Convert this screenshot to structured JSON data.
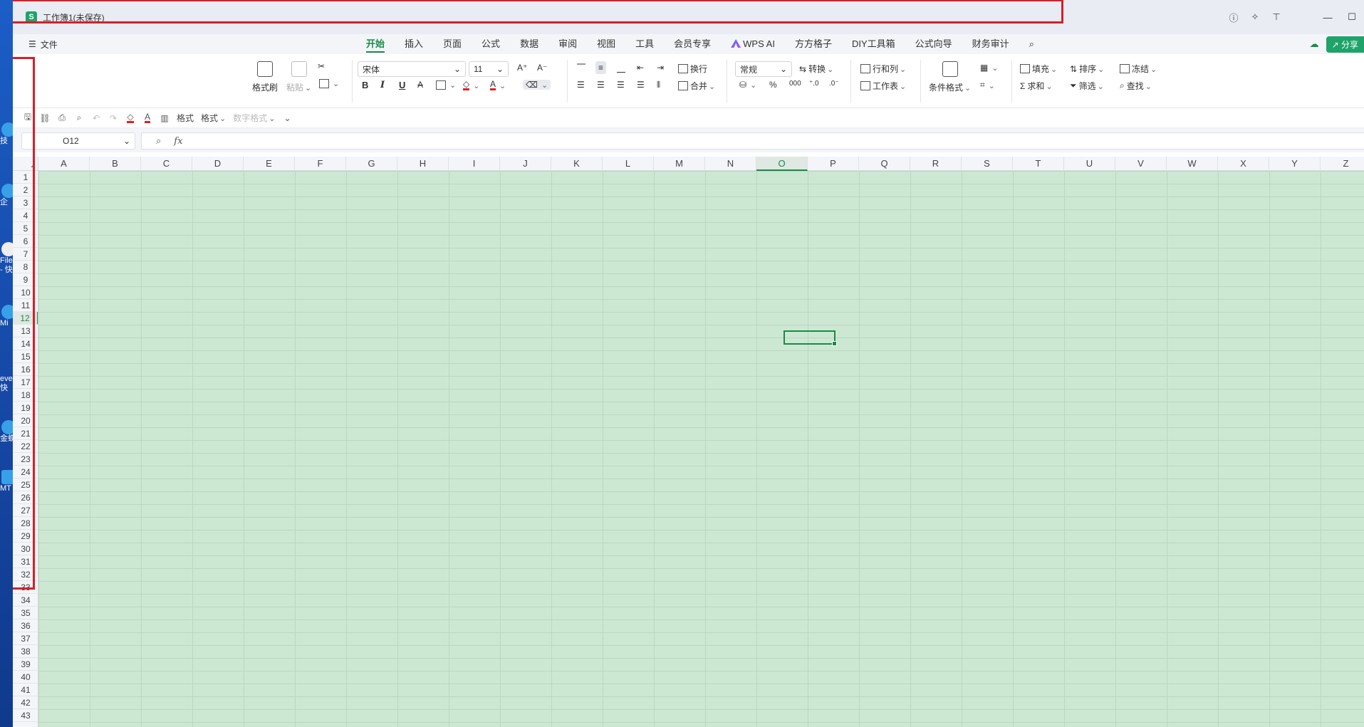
{
  "desktop": {
    "icons": [
      "技",
      "企",
      "File",
      "- 快",
      "Mi",
      "eve",
      "快",
      "金蝶",
      "MT"
    ]
  },
  "window": {
    "title": "工作簿1(未保存)",
    "app_letter": "S"
  },
  "menubar": {
    "file_label": "文件",
    "tabs": [
      "开始",
      "插入",
      "页面",
      "公式",
      "数据",
      "审阅",
      "视图",
      "工具",
      "会员专享",
      "WPS AI",
      "方方格子",
      "DIY工具箱",
      "公式向导",
      "财务审计"
    ],
    "active_tab": "开始",
    "share_label": "分享"
  },
  "ribbon": {
    "format_painter": "格式刷",
    "paste": "粘贴",
    "font_name": "宋体",
    "font_size": "11",
    "wrap": "换行",
    "merge": "合并",
    "number_format": "常规",
    "convert": "转换",
    "rows_cols": "行和列",
    "worksheet": "工作表",
    "conditional_format": "条件格式",
    "fill": "填充",
    "sort": "排序",
    "freeze": "冻结",
    "sum": "求和",
    "filter": "筛选",
    "find": "查找",
    "bold": "B",
    "italic": "I",
    "underline": "U",
    "font_color_glyph": "A"
  },
  "quickbar": {
    "format_label": "格式",
    "format_dropdown": "格式",
    "number_format_label": "数字格式"
  },
  "formula": {
    "cell_ref": "O12",
    "fx": "fx",
    "value": ""
  },
  "grid": {
    "columns": [
      "A",
      "B",
      "C",
      "D",
      "E",
      "F",
      "G",
      "H",
      "I",
      "J",
      "K",
      "L",
      "M",
      "N",
      "O",
      "P",
      "Q",
      "R",
      "S",
      "T",
      "U",
      "V",
      "W",
      "X",
      "Y",
      "Z"
    ],
    "active_column": "O",
    "rows": [
      "1",
      "2",
      "3",
      "4",
      "5",
      "6",
      "7",
      "8",
      "9",
      "10",
      "11",
      "12",
      "13",
      "14",
      "15",
      "16",
      "17",
      "18",
      "19",
      "20",
      "21",
      "22",
      "23",
      "24",
      "25",
      "26",
      "27",
      "28",
      "29",
      "30",
      "31",
      "32",
      "33",
      "34",
      "35",
      "36",
      "37",
      "38",
      "39",
      "40",
      "41",
      "42",
      "43"
    ],
    "active_row": "12"
  },
  "colors": {
    "accent": "#1a8a4a",
    "cell_fill": "#cde8d2",
    "annotation": "#d81e2a"
  }
}
